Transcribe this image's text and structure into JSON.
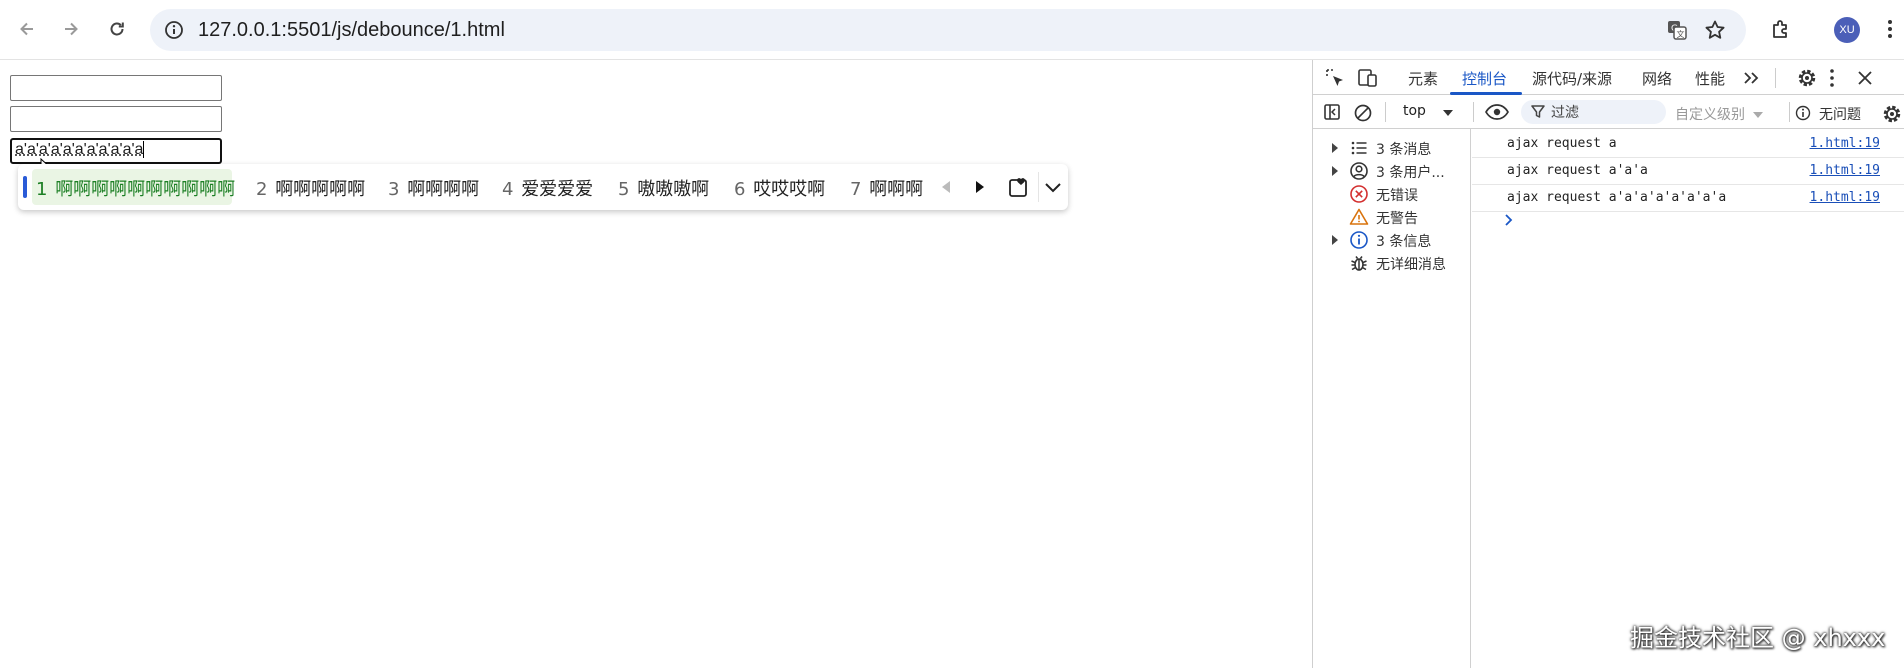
{
  "browser": {
    "url": "127.0.0.1:5501/js/debounce/1.html",
    "avatar_initials": "XU",
    "accent": "#1a57c6"
  },
  "page": {
    "inputs": [
      "",
      "",
      "a'a'a'a'a'a'a'a'a'a'a"
    ]
  },
  "ime": {
    "candidates": [
      {
        "num": "1",
        "text": "啊啊啊啊啊啊啊啊啊啊"
      },
      {
        "num": "2",
        "text": "啊啊啊啊啊"
      },
      {
        "num": "3",
        "text": "啊啊啊啊"
      },
      {
        "num": "4",
        "text": "爱爱爱爱"
      },
      {
        "num": "5",
        "text": "嗷嗷嗷啊"
      },
      {
        "num": "6",
        "text": "哎哎哎啊"
      },
      {
        "num": "7",
        "text": "啊啊啊"
      }
    ],
    "selected_color": "#1c7f24"
  },
  "devtools": {
    "tabs": [
      "元素",
      "控制台",
      "源代码/来源",
      "网络",
      "性能"
    ],
    "active_tab": "控制台",
    "context": "top",
    "filter_placeholder": "过滤",
    "levels": "自定义级别",
    "issues": "无问题",
    "sidebar": [
      {
        "label": "3 条消息",
        "icon": "list-icon",
        "expandable": true
      },
      {
        "label": "3 条用户...",
        "icon": "user-icon",
        "expandable": true
      },
      {
        "label": "无错误",
        "icon": "error-icon",
        "expandable": false
      },
      {
        "label": "无警告",
        "icon": "warning-icon",
        "expandable": false
      },
      {
        "label": "3 条信息",
        "icon": "info-icon",
        "expandable": true
      },
      {
        "label": "无详细消息",
        "icon": "bug-icon",
        "expandable": false
      }
    ],
    "logs": [
      {
        "message": "ajax request a",
        "source": "1.html:19"
      },
      {
        "message": "ajax request a'a'a",
        "source": "1.html:19"
      },
      {
        "message": "ajax request a'a'a'a'a'a'a'a",
        "source": "1.html:19"
      }
    ]
  },
  "watermark": "掘金技术社区 @ xhxxx"
}
